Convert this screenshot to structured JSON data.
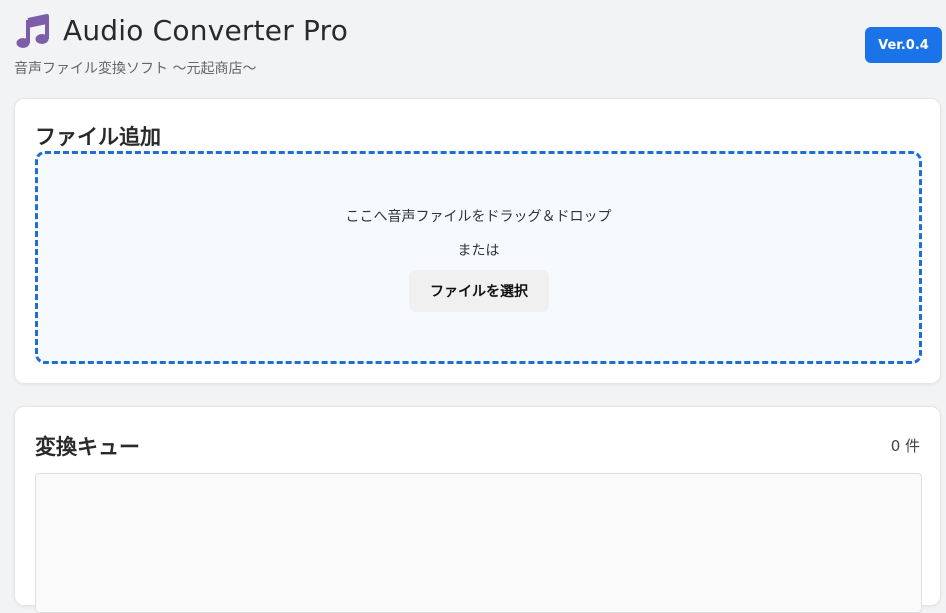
{
  "header": {
    "title": "Audio Converter Pro",
    "subtitle": "音声ファイル変換ソフト 〜元起商店〜",
    "version": "Ver.0.4",
    "logo_icon": "music-note-icon"
  },
  "add_section": {
    "title": "ファイル追加",
    "drop_text": "ここへ音声ファイルをドラッグ＆ドロップ",
    "or_text": "または",
    "select_button_label": "ファイルを選択"
  },
  "queue_section": {
    "title": "変換キュー",
    "count": "0 件"
  },
  "colors": {
    "accent": "#1a73e8",
    "dropzone_border": "#1f6fd1",
    "logo": "#7b5ea7"
  }
}
